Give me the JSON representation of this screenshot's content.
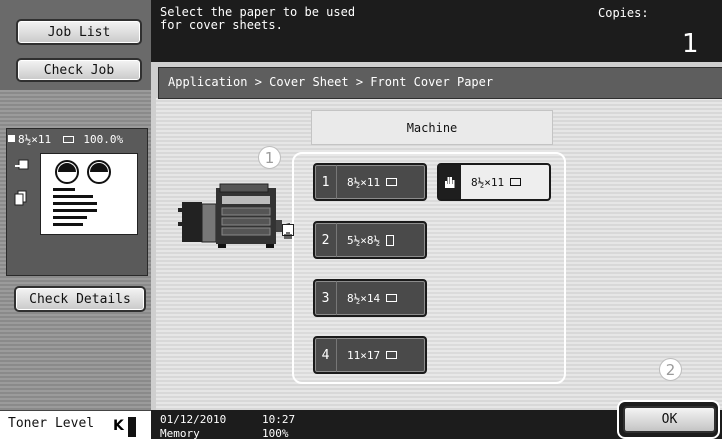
{
  "left_panel": {
    "job_list_label": "Job List",
    "check_job_label": "Check Job",
    "preview_paper": "8½×11",
    "preview_zoom": "100.0%",
    "check_details_label": "Check Details",
    "toner_label": "Toner Level",
    "toner_color": "K"
  },
  "header": {
    "instruction": "Select the paper to be used\nfor cover sheets.",
    "copies_label": "Copies:",
    "copies_value": "1"
  },
  "breadcrumb": "Application > Cover Sheet > Front Cover Paper",
  "machine_header": "Machine",
  "callouts": {
    "one": "1",
    "two": "2"
  },
  "trays": [
    {
      "number": "1",
      "size": "8½×11"
    },
    {
      "number": "2",
      "size": "5½×8½"
    },
    {
      "number": "3",
      "size": "8½×14"
    },
    {
      "number": "4",
      "size": "11×17"
    }
  ],
  "bypass_tray": {
    "size": "8½×11",
    "icon": "hand-icon"
  },
  "status": {
    "date": "01/12/2010",
    "time": "10:27",
    "memory_label": "Memory",
    "memory_value": "100%"
  },
  "ok_label": "OK"
}
